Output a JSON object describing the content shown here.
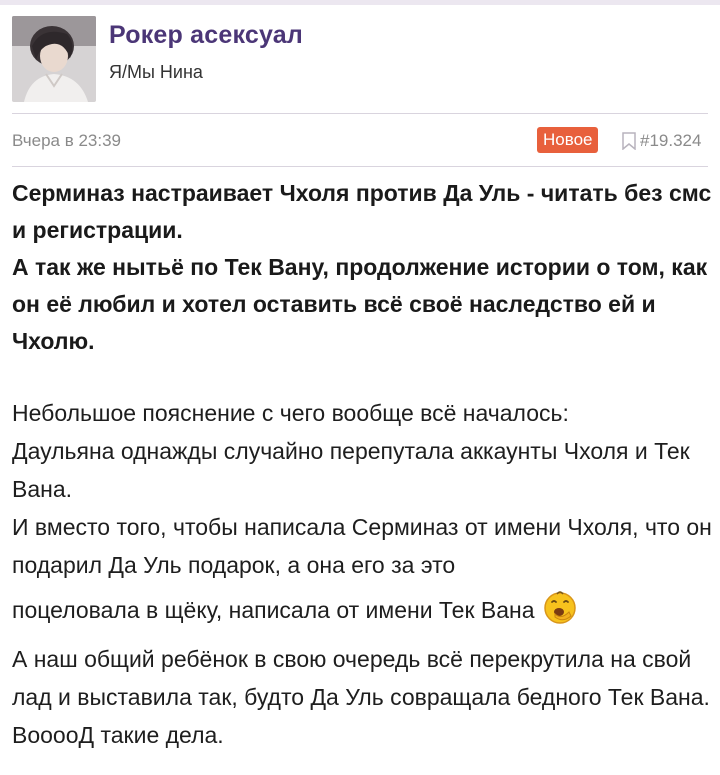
{
  "author": {
    "name": "Рокер асексуал",
    "status": "Я/Мы Нина"
  },
  "meta": {
    "date": "Вчера в 23:39",
    "badge": "Новое",
    "post_number": "#19.324",
    "badge_color": "#e8603c",
    "accent_color": "#4b3677"
  },
  "title": {
    "line1": "Серминаз настраивает Чхоля против Да Уль - читать без смс и регистрации.",
    "line2": "А так же нытьё по Тек Вану, продолжение истории о том, как он её любил и хотел оставить всё своё наследство ей и Чхолю."
  },
  "body": {
    "p1": "Небольшое пояснение с чего вообще всё началось:",
    "p2": "Даульяна однажды случайно перепутала аккаунты Чхоля и Тек Вана.",
    "p3": "И вместо того, чтобы написала Серминаз от имени Чхоля, что он подарил Да Уль подарок, а она его за это",
    "p4": "поцеловала в щёку, написала от имени Тек Вана",
    "p5": "А наш общий ребёнок в свою очередь всё перекрутила на свой лад и выставила так, будто Да Уль совращала бедного Тек Вана.",
    "p6": "ВооооД такие дела.",
    "emoji": "yawning-face-icon"
  }
}
